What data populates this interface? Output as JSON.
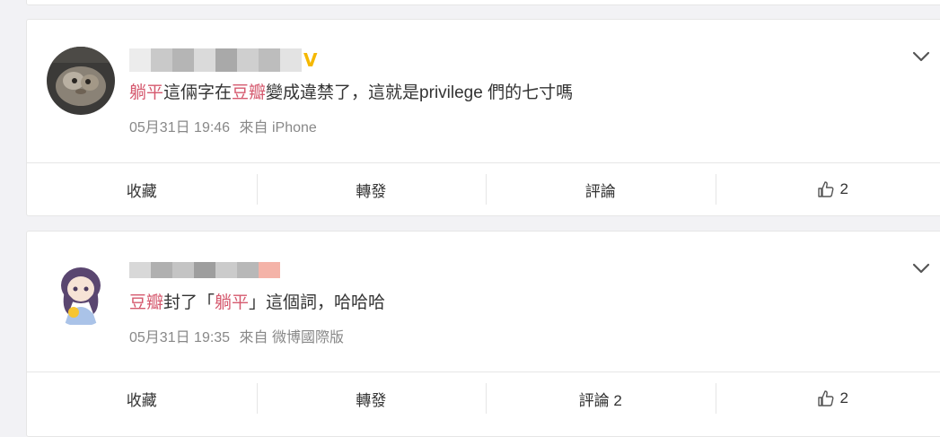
{
  "posts": [
    {
      "content": {
        "tag1": "躺平",
        "text1": "這倆字在",
        "tag2": "豆瓣",
        "text2": "變成違禁了，這就是privilege 們的七寸嗎"
      },
      "timestamp": "05月31日 19:46",
      "source": "來自 iPhone",
      "verified_badge": "V",
      "actions": {
        "favorite": "收藏",
        "repost": "轉發",
        "comment": "評論",
        "like_count": "2"
      }
    },
    {
      "content": {
        "tag1": "豆瓣",
        "text1": "封了「",
        "tag2": "躺平",
        "text2": "」這個詞，哈哈哈"
      },
      "timestamp": "05月31日 19:35",
      "source": "來自 微博國際版",
      "actions": {
        "favorite": "收藏",
        "repost": "轉發",
        "comment": "評論 2",
        "like_count": "2"
      }
    }
  ],
  "icons": {
    "more": "chevron-down-icon",
    "like": "thumbs-up-icon",
    "verified": "verified-badge-icon"
  },
  "colors": {
    "tag": "#d5596e",
    "badge": "#f5b800",
    "meta": "#888888"
  }
}
